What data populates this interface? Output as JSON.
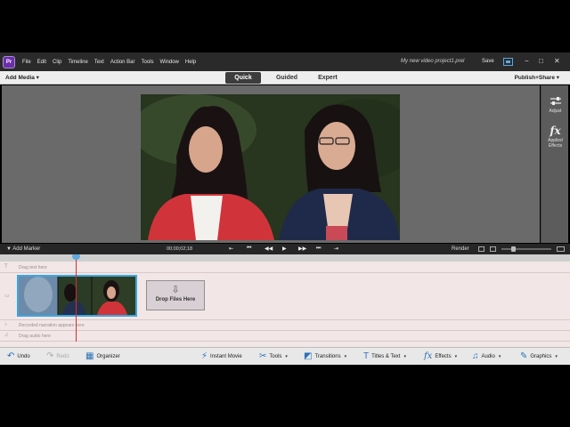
{
  "app": {
    "icon_text": "Pr",
    "menus": [
      "File",
      "Edit",
      "Clip",
      "Timeline",
      "Text",
      "Action Bar",
      "Tools",
      "Window",
      "Help"
    ],
    "project_title": "My new video project1.prel",
    "save_label": "Save",
    "window_controls": [
      "−",
      "□",
      "✕"
    ]
  },
  "modebar": {
    "add_media": "Add Media ▾",
    "tabs": [
      "Quick",
      "Guided",
      "Expert"
    ],
    "active_tab": "Quick",
    "publish": "Publish+Share ▾"
  },
  "right_panel": {
    "adjust_label": "Adjust",
    "applied_effects_label": "Applied Effects",
    "fx_glyph": "fx"
  },
  "transport": {
    "add_marker": "Add Marker",
    "timecode": "00;00;02;18",
    "buttons": [
      "⇤",
      "⏮",
      "◀◀",
      "▶",
      "▶▶",
      "⏭",
      "⇥"
    ],
    "render": "Render"
  },
  "timeline": {
    "text_hint": "Drag text here",
    "narration_hint": "Recorded narration appears here",
    "audio_hint": "Drag audio here",
    "drop_label": "Drop Files Here",
    "drop_arrow": "⇩"
  },
  "actionbar": {
    "undo": "Undo",
    "redo": "Redo",
    "organizer": "Organizer",
    "instant_movie": "Instant Movie",
    "tools": "Tools",
    "transitions": "Transitions",
    "titles_text": "Titles & Text",
    "effects": "Effects",
    "audio": "Audio",
    "graphics": "Graphics"
  },
  "colors": {
    "accent": "#3aa6e0",
    "brand": "#6b2fa8"
  }
}
